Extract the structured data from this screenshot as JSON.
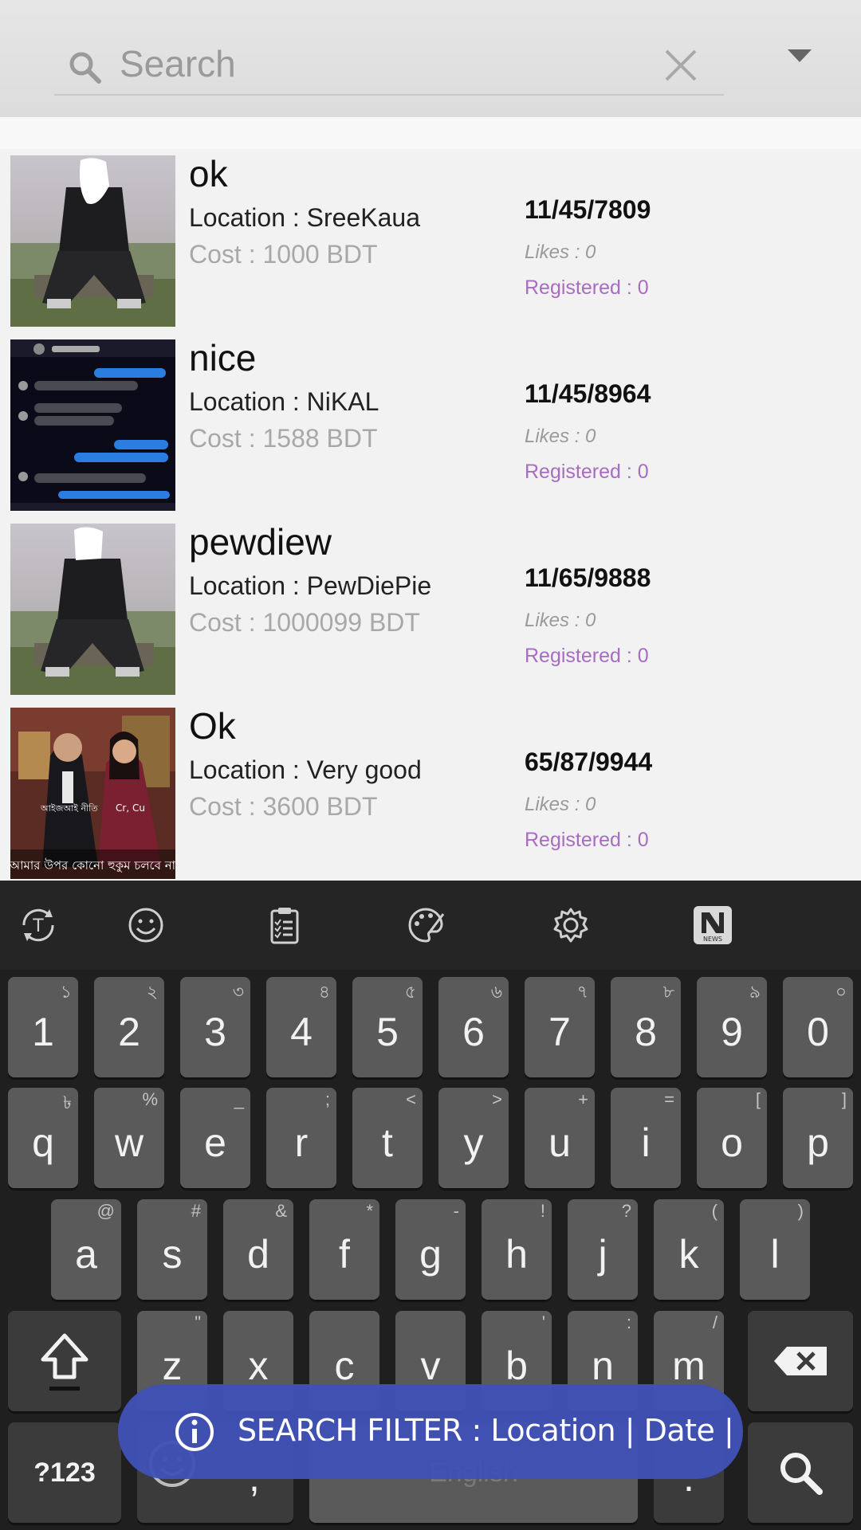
{
  "search": {
    "placeholder": "Search"
  },
  "listings": [
    {
      "title": "ok",
      "location": "Location : SreeKaua",
      "cost": "Cost : 1000 BDT",
      "code": "11/45/7809",
      "likes": "Likes : 0",
      "registered": "Registered : 0"
    },
    {
      "title": "nice",
      "location": "Location : NiKAL",
      "cost": "Cost : 1588 BDT",
      "code": "11/45/8964",
      "likes": "Likes : 0",
      "registered": "Registered : 0"
    },
    {
      "title": "pewdiew",
      "location": "Location : PewDiePie",
      "cost": "Cost : 1000099 BDT",
      "code": "11/65/9888",
      "likes": "Likes : 0",
      "registered": "Registered : 0"
    },
    {
      "title": "Ok",
      "location": "Location : Very good",
      "cost": "Cost : 3600 BDT",
      "code": "65/87/9944",
      "likes": "Likes : 0",
      "registered": "Registered : 0"
    }
  ],
  "image_text": {
    "bengali_caption": "আমার উপর কোনো হুকুম চলবে না",
    "side_text_left": "আইজআই নীতি",
    "side_text_right": "Cr, Cu"
  },
  "keyboard": {
    "toolbar_icons": [
      "text-style-icon",
      "emoji-icon",
      "clipboard-icon",
      "palette-icon",
      "settings-icon",
      "news-icon"
    ],
    "news_label": "NEWS",
    "number_row": [
      {
        "key": "1",
        "hint": "১"
      },
      {
        "key": "2",
        "hint": "২"
      },
      {
        "key": "3",
        "hint": "৩"
      },
      {
        "key": "4",
        "hint": "৪"
      },
      {
        "key": "5",
        "hint": "৫"
      },
      {
        "key": "6",
        "hint": "৬"
      },
      {
        "key": "7",
        "hint": "৭"
      },
      {
        "key": "8",
        "hint": "৮"
      },
      {
        "key": "9",
        "hint": "৯"
      },
      {
        "key": "0",
        "hint": "০"
      }
    ],
    "row_q": [
      {
        "key": "q",
        "hint": "৳"
      },
      {
        "key": "w",
        "hint": "%"
      },
      {
        "key": "e",
        "hint": "_"
      },
      {
        "key": "r",
        "hint": ";"
      },
      {
        "key": "t",
        "hint": "<"
      },
      {
        "key": "y",
        "hint": ">"
      },
      {
        "key": "u",
        "hint": "+"
      },
      {
        "key": "i",
        "hint": "="
      },
      {
        "key": "o",
        "hint": "["
      },
      {
        "key": "p",
        "hint": "]"
      }
    ],
    "row_a": [
      {
        "key": "a",
        "hint": "@"
      },
      {
        "key": "s",
        "hint": "#"
      },
      {
        "key": "d",
        "hint": "&"
      },
      {
        "key": "f",
        "hint": "*"
      },
      {
        "key": "g",
        "hint": "-"
      },
      {
        "key": "h",
        "hint": "!"
      },
      {
        "key": "j",
        "hint": "?"
      },
      {
        "key": "k",
        "hint": "("
      },
      {
        "key": "l",
        "hint": ")"
      }
    ],
    "row_z": [
      {
        "key": "z",
        "hint": "\""
      },
      {
        "key": "x",
        "hint": ""
      },
      {
        "key": "c",
        "hint": ""
      },
      {
        "key": "v",
        "hint": ""
      },
      {
        "key": "b",
        "hint": "'"
      },
      {
        "key": "n",
        "hint": ":"
      },
      {
        "key": "m",
        "hint": "/"
      }
    ],
    "symbols_label": "?123",
    "comma_label": ",",
    "space_label": "English",
    "period_label": "."
  },
  "toast": {
    "text": "SEARCH FILTER : Location | Date |"
  },
  "colors": {
    "accent": "#3f51b5",
    "registered": "#a86cc3",
    "keyboard_bg": "#1f1f1f",
    "key_bg": "#5a5a5a"
  }
}
